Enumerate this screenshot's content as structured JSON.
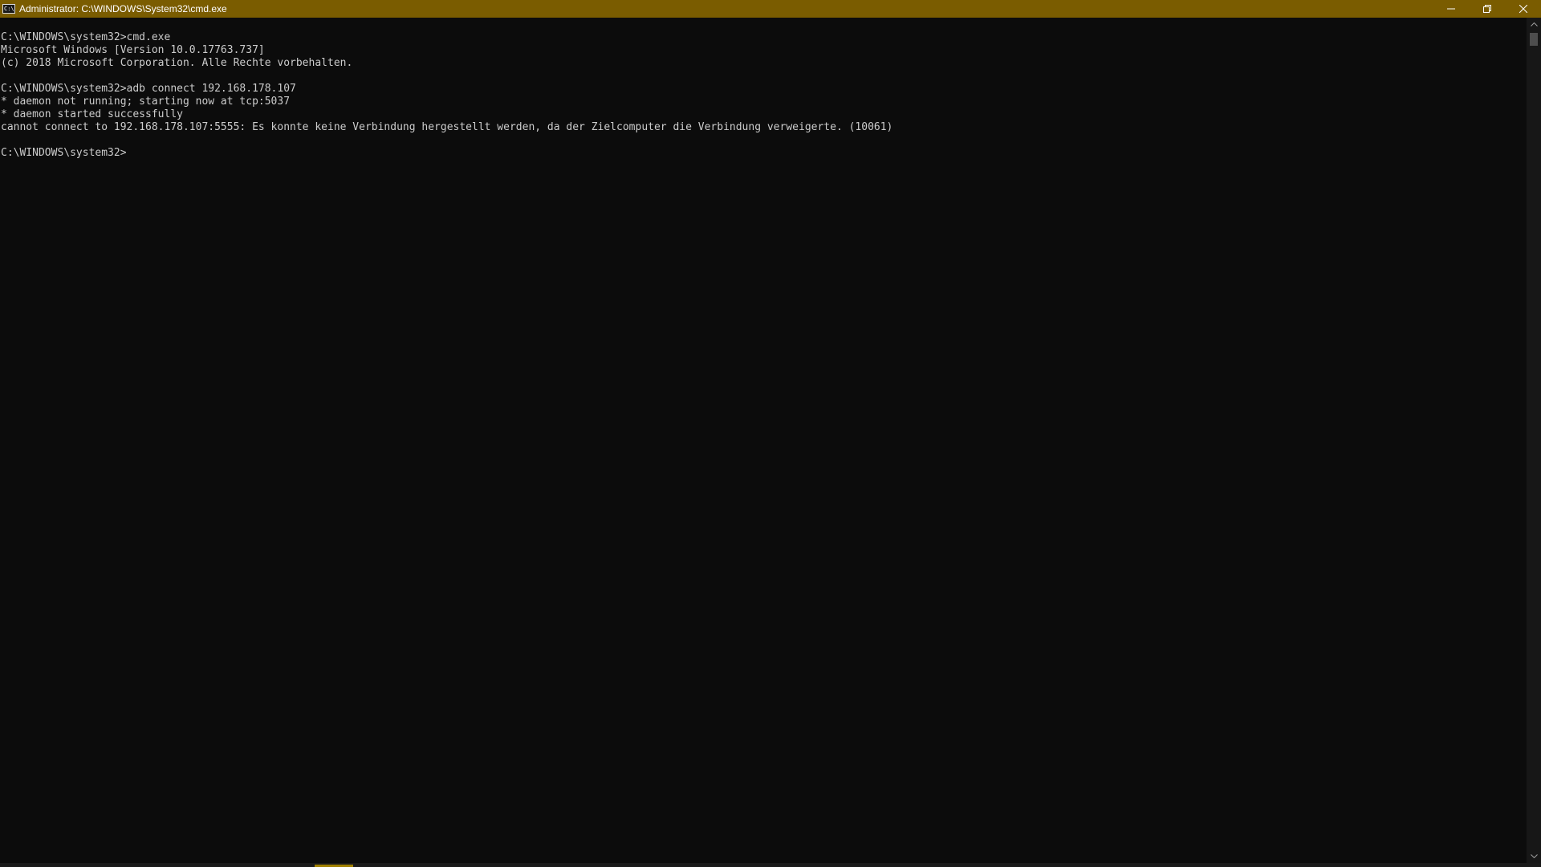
{
  "window": {
    "title": "Administrator: C:\\WINDOWS\\System32\\cmd.exe",
    "icon_glyph": "C:\\",
    "accent_color": "#7a5c00",
    "controls": {
      "minimize": "minimize-icon",
      "restore": "restore-icon",
      "close": "close-icon"
    }
  },
  "console": {
    "background": "#0c0c0c",
    "foreground": "#cccccc",
    "lines": [
      "C:\\WINDOWS\\system32>cmd.exe",
      "Microsoft Windows [Version 10.0.17763.737]",
      "(c) 2018 Microsoft Corporation. Alle Rechte vorbehalten.",
      "",
      "C:\\WINDOWS\\system32>adb connect 192.168.178.107",
      "* daemon not running; starting now at tcp:5037",
      "* daemon started successfully",
      "cannot connect to 192.168.178.107:5555: Es konnte keine Verbindung hergestellt werden, da der Zielcomputer die Verbindung verweigerte. (10061)",
      "",
      "C:\\WINDOWS\\system32>"
    ]
  }
}
